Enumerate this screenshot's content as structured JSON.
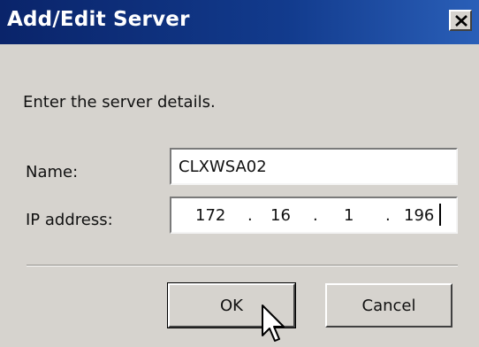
{
  "window": {
    "title": "Add/Edit Server",
    "close_icon": "close-icon"
  },
  "prompt": "Enter the server details.",
  "form": {
    "name_label": "Name:",
    "name_value": "CLXWSA02",
    "ip_label": "IP address:",
    "ip_octets": [
      "172",
      "16",
      "1",
      "196"
    ],
    "ip_dot": "."
  },
  "buttons": {
    "ok_label": "OK",
    "cancel_label": "Cancel"
  },
  "colors": {
    "titlebar_start": "#0a246a",
    "titlebar_end": "#2a5fb8",
    "dialog_bg": "#d6d3ce"
  }
}
